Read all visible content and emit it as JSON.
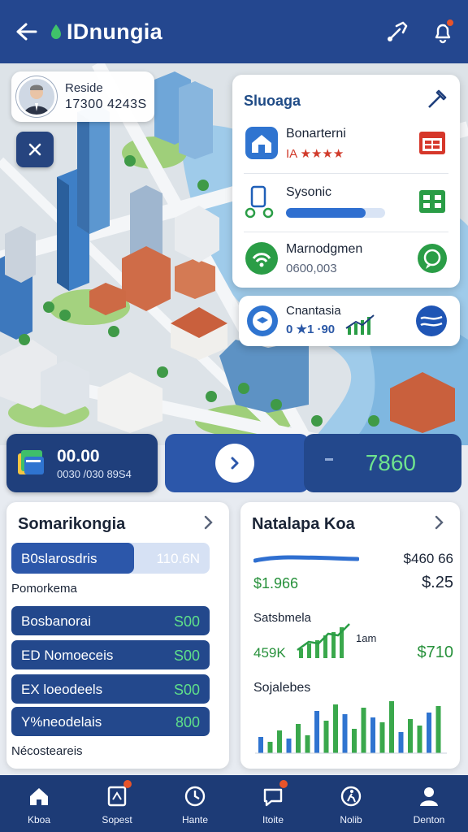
{
  "header": {
    "title": "IDnungia",
    "back_icon": "arrow-left-icon",
    "icons": [
      "share-icon",
      "notification-icon"
    ]
  },
  "profile": {
    "name": "Reside",
    "number": "17300 4243S"
  },
  "side_panel": {
    "title": "Sluoaga",
    "rows": [
      {
        "label": "Bonarterni",
        "sub": "IA ★★★★",
        "icon": "home-icon",
        "right_icon": "calendar-icon"
      },
      {
        "label": "Sysonic",
        "sub": "",
        "icon": "transit-icon",
        "right_icon": "grid-icon",
        "progress": 0.8
      },
      {
        "label": "Marnodgmen",
        "sub": "0600,003",
        "icon": "wifi-icon",
        "right_icon": "chat-icon"
      }
    ]
  },
  "floating_card": {
    "label": "Cnantasia",
    "sub": "0 ★1 ·90"
  },
  "stats": {
    "amount": "00.00",
    "amount_sub": "0030 /030 89S4",
    "value": "7860"
  },
  "left_panel": {
    "title": "Somarikongia",
    "progress": {
      "label": "B0slarosdris",
      "value": "110.6N",
      "fill": 0.62
    },
    "sub_label": "Pomorkema",
    "items": [
      {
        "label": "Bosbanorai",
        "value": "S00"
      },
      {
        "label": "ED Nomoeceis",
        "value": "S00"
      },
      {
        "label": "EX loeodeels",
        "value": "S00"
      },
      {
        "label": "Y%neodelais",
        "value": "800"
      }
    ],
    "footer": "Nécosteareis"
  },
  "right_panel": {
    "title": "Natalapa Koa",
    "price": "$460 66",
    "green_value": "$1.966",
    "dark_value": "$.25",
    "sub1": "Satsbmela",
    "chart_value": "459K",
    "chart_note": "1am",
    "right_value": "$710",
    "sub2": "Sojalebes"
  },
  "nav": [
    {
      "label": "Kboa",
      "icon": "home-icon"
    },
    {
      "label": "Sopest",
      "icon": "tablet-icon",
      "badge": true
    },
    {
      "label": "Hante",
      "icon": "clock-icon"
    },
    {
      "label": "Itoite",
      "icon": "chat-bubble-icon",
      "badge": true
    },
    {
      "label": "Nolib",
      "icon": "walk-icon"
    },
    {
      "label": "Denton",
      "icon": "profile-icon"
    }
  ]
}
